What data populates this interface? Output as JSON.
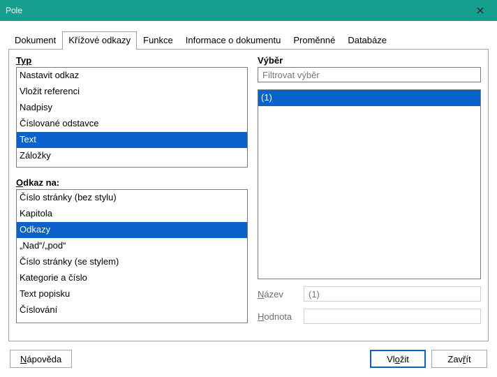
{
  "window": {
    "title": "Pole"
  },
  "tabs": {
    "items": [
      {
        "label": "Dokument"
      },
      {
        "label": "Křížové odkazy"
      },
      {
        "label": "Funkce"
      },
      {
        "label": "Informace o dokumentu"
      },
      {
        "label": "Proměnné"
      },
      {
        "label": "Databáze"
      }
    ],
    "active_index": 1
  },
  "left": {
    "type_label": "Typ",
    "type_items": [
      "Nastavit odkaz",
      "Vložit referenci",
      "Nadpisy",
      "Číslované odstavce",
      "Text",
      "Záložky"
    ],
    "type_selected_index": 4,
    "ref_label_prefix": "O",
    "ref_label_rest": "dkaz na:",
    "ref_items": [
      "Číslo stránky (bez stylu)",
      "Kapitola",
      "Odkazy",
      "„Nad“/„pod“",
      "Číslo stránky (se stylem)",
      "Kategorie a číslo",
      "Text popisku",
      "Číslování"
    ],
    "ref_selected_index": 2
  },
  "right": {
    "select_label": "Výběr",
    "filter_placeholder": "Filtrovat výběr",
    "filter_value": "",
    "items": [
      "(1)"
    ],
    "selected_index": 0,
    "name_label_u": "N",
    "name_label_rest": "ázev",
    "name_value": "(1)",
    "value_label_u": "H",
    "value_label_rest": "odnota",
    "value_value": ""
  },
  "footer": {
    "help_u": "N",
    "help_rest": "ápověda",
    "insert_pre": "Vl",
    "insert_u": "o",
    "insert_post": "žit",
    "close_pre": "Zav",
    "close_u": "ř",
    "close_post": "ít"
  }
}
